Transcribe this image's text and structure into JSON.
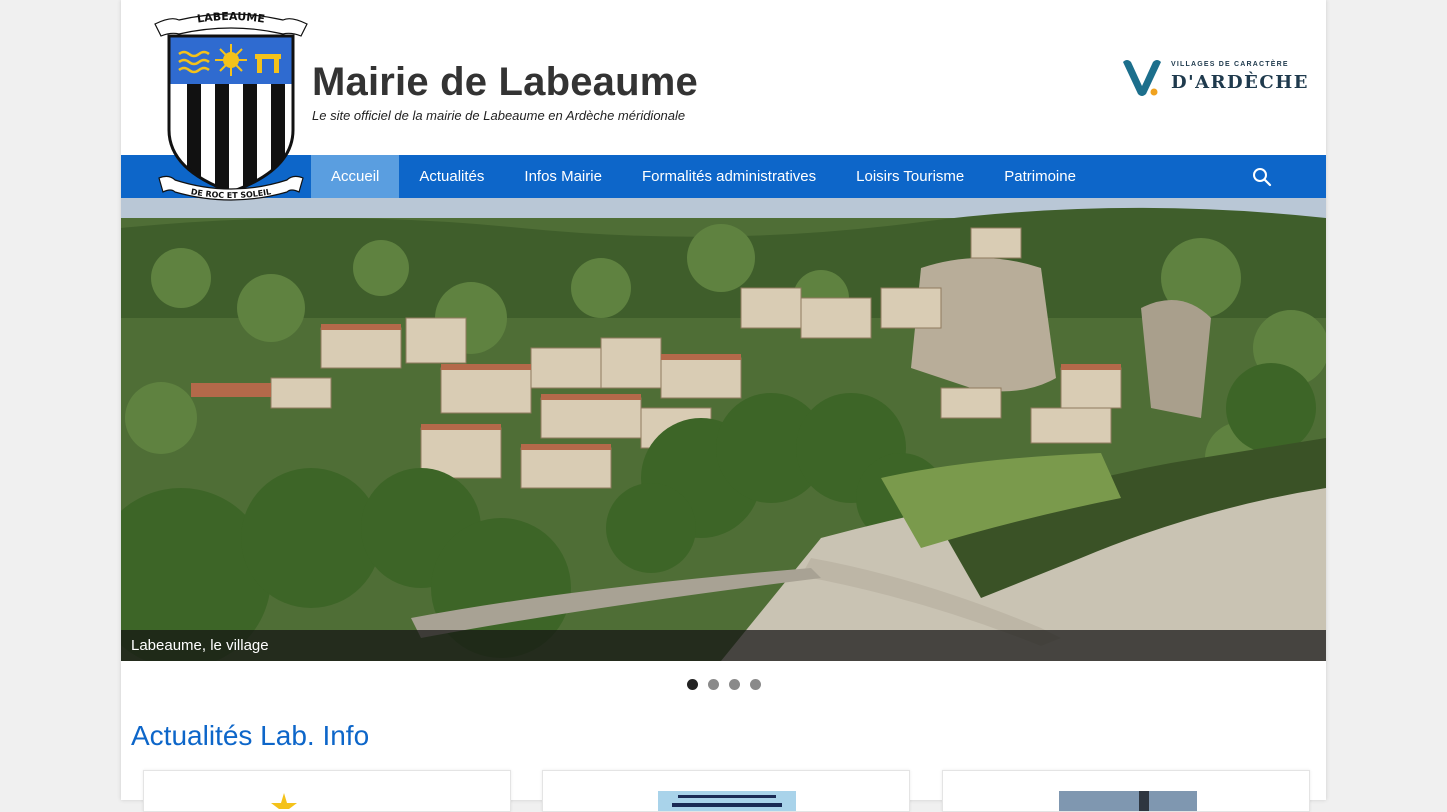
{
  "header": {
    "title": "Mairie de Labeaume",
    "tagline": "Le site officiel de la mairie de Labeaume en Ardèche méridionale",
    "crest": {
      "top_banner": "LABEAUME",
      "bottom_banner": "DE ROC ET SOLEIL"
    },
    "partner_logo": {
      "small_text": "VILLAGES DE CARACTÈRE",
      "big_text": "D'ARDÈCHE"
    }
  },
  "nav": {
    "items": [
      {
        "label": "Accueil",
        "active": true
      },
      {
        "label": "Actualités",
        "active": false
      },
      {
        "label": "Infos Mairie",
        "active": false
      },
      {
        "label": "Formalités administratives",
        "active": false
      },
      {
        "label": "Loisirs Tourisme",
        "active": false
      },
      {
        "label": "Patrimoine",
        "active": false
      }
    ],
    "search_icon": "search-icon"
  },
  "slider": {
    "caption": "Labeaume, le village",
    "total_slides": 4,
    "active_slide": 1
  },
  "news": {
    "section_title": "Actualités Lab. Info",
    "cards": [
      {
        "thumb": "sun-thumbnail"
      },
      {
        "thumb": "exposition-poster-thumbnail"
      },
      {
        "thumb": "photo-thumbnail"
      }
    ]
  },
  "colors": {
    "nav_bg": "#0d66c9",
    "nav_active": "#5a9ee0",
    "section_title": "#0d66c9",
    "page_bg": "#f0f0f0"
  }
}
